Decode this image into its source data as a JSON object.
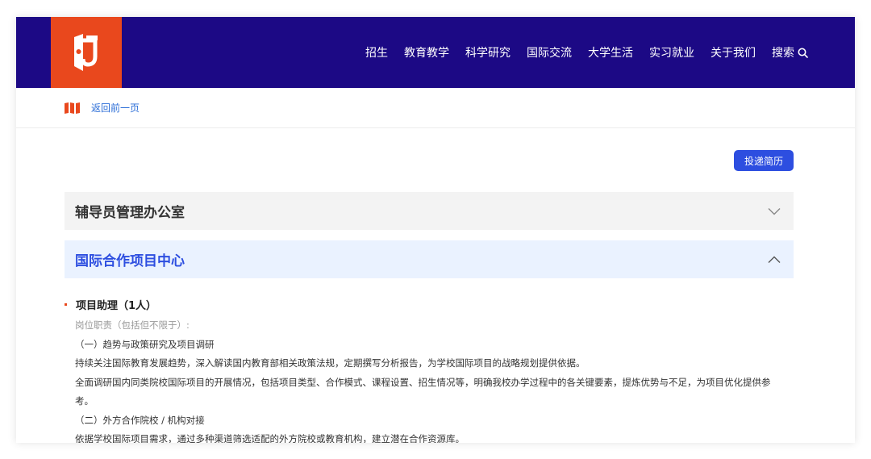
{
  "header": {
    "nav": [
      "招生",
      "教育教学",
      "科学研究",
      "国际交流",
      "大学生活",
      "实习就业",
      "关于我们"
    ],
    "search_label": "搜索"
  },
  "breadcrumb": {
    "back_label": "返回前一页"
  },
  "apply_label": "投递简历",
  "accordions": [
    {
      "title": "辅导员管理办公室",
      "expanded": false
    },
    {
      "title": "国际合作项目中心",
      "expanded": true
    }
  ],
  "job": {
    "title": "项目助理（1人）",
    "duty_heading": "岗位职责（包括但不限于）:",
    "lines": [
      "（一）趋势与政策研究及项目调研",
      "持续关注国际教育发展趋势，深入解读国内教育部相关政策法规，定期撰写分析报告，为学校国际项目的战略规划提供依据。",
      "全面调研国内同类院校国际项目的开展情况，包括项目类型、合作模式、课程设置、招生情况等，明确我校办学过程中的各关键要素，提炼优势与不足，为项目优化提供参",
      "考。",
      "（二）外方合作院校 / 机构对接",
      "依据学校国际项目需求，通过多种渠道筛选适配的外方院校或教育机构，建立潜在合作资源库。"
    ]
  },
  "colors": {
    "header_bg": "#1c0985",
    "logo_bg": "#e9481d",
    "accent_blue": "#2d4ee0",
    "link_blue": "#2c6ed7",
    "accent_orange": "#e9481d"
  }
}
